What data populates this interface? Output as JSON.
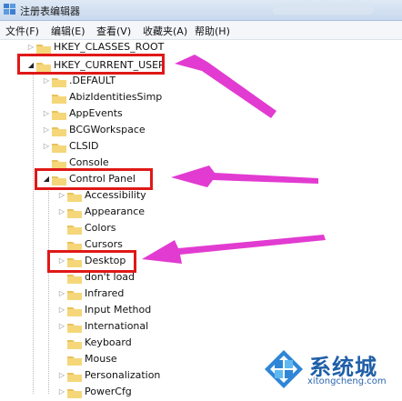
{
  "window": {
    "title": "注册表编辑器"
  },
  "menu": {
    "file": "文件(F)",
    "edit": "编辑(E)",
    "view": "查看(V)",
    "favorites": "收藏夹(A)",
    "help": "帮助(H)"
  },
  "tree": {
    "classes_root": "HKEY_CLASSES_ROOT",
    "current_user": "HKEY_CURRENT_USER",
    "level1": [
      ".DEFAULT",
      "AbizIdentitiesSimp",
      "AppEvents",
      "BCGWorkspace",
      "CLSID",
      "Console",
      "Control Panel"
    ],
    "level2": [
      "Accessibility",
      "Appearance",
      "Colors",
      "Cursors",
      "Desktop",
      "don't load",
      "Infrared",
      "Input Method",
      "International",
      "Keyboard",
      "Mouse",
      "Personalization",
      "PowerCfg"
    ]
  },
  "colors": {
    "highlight_box": "#e01818",
    "arrow": "#e23bd1",
    "watermark": "#1f5fa8"
  },
  "icons": {
    "app": "regedit-icon",
    "folder": "folder-icon",
    "expand": "triangle-expand-icon"
  },
  "watermark": {
    "brand": "系统城",
    "url": "xitongcheng.com"
  }
}
